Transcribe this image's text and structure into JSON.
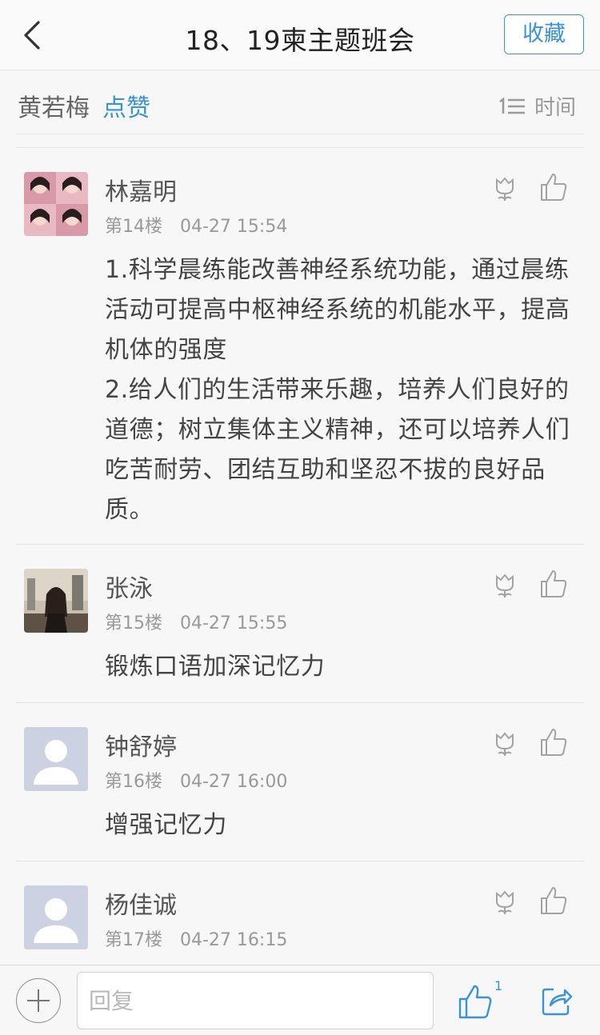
{
  "nav": {
    "title": "18、19柬主题班会",
    "favorite_label": "收藏"
  },
  "likes": {
    "user": "黄若梅",
    "action": "点赞",
    "sort_label": "时间"
  },
  "comments": [
    {
      "name": "林嘉明",
      "floor": "第14楼",
      "time": "04-27 15:54",
      "text": "1.科学晨练能改善神经系统功能，通过晨练活动可提高中枢神经系统的机能水平，提高机体的强度\n2.给人们的生活带来乐趣，培养人们良好的道德；树立集体主义精神，还可以培养人们吃苦耐劳、团结互助和坚忍不拔的良好品质。"
    },
    {
      "name": "张泳",
      "floor": "第15楼",
      "time": "04-27 15:55",
      "text": "锻炼口语加深记忆力"
    },
    {
      "name": "钟舒婷",
      "floor": "第16楼",
      "time": "04-27 16:00",
      "text": "增强记忆力"
    },
    {
      "name": "杨佳诚",
      "floor": "第17楼",
      "time": "04-27 16:15",
      "text": ""
    }
  ],
  "bottom": {
    "reply_placeholder": "回复",
    "like_count": "1"
  },
  "colors": {
    "accent": "#3a93d6",
    "avatar_default": "#cdd2e2"
  }
}
